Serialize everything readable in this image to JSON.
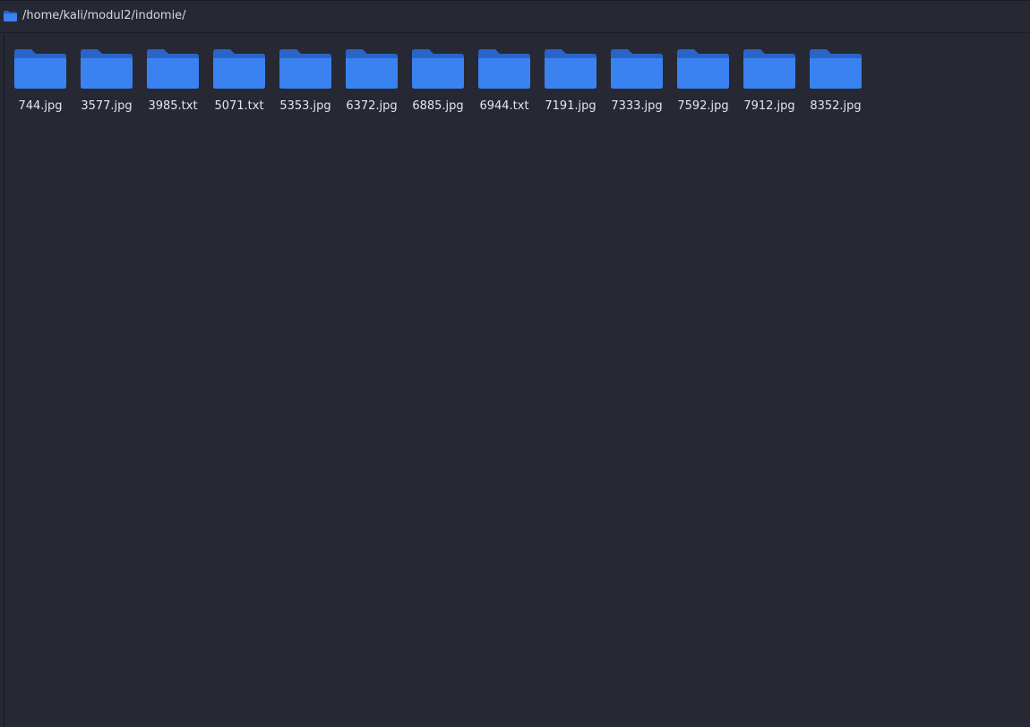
{
  "location": {
    "path": "/home/kali/modul2/indomie/",
    "icon": "folder-icon"
  },
  "colors": {
    "background": "#262833",
    "folder_front": "#3b82f1",
    "folder_back": "#2a64c9",
    "text": "#e4e6ea"
  },
  "items": [
    {
      "name": "744.jpg",
      "icon": "folder-icon"
    },
    {
      "name": "3577.jpg",
      "icon": "folder-icon"
    },
    {
      "name": "3985.txt",
      "icon": "folder-icon"
    },
    {
      "name": "5071.txt",
      "icon": "folder-icon"
    },
    {
      "name": "5353.jpg",
      "icon": "folder-icon"
    },
    {
      "name": "6372.jpg",
      "icon": "folder-icon"
    },
    {
      "name": "6885.jpg",
      "icon": "folder-icon"
    },
    {
      "name": "6944.txt",
      "icon": "folder-icon"
    },
    {
      "name": "7191.jpg",
      "icon": "folder-icon"
    },
    {
      "name": "7333.jpg",
      "icon": "folder-icon"
    },
    {
      "name": "7592.jpg",
      "icon": "folder-icon"
    },
    {
      "name": "7912.jpg",
      "icon": "folder-icon"
    },
    {
      "name": "8352.jpg",
      "icon": "folder-icon"
    }
  ]
}
